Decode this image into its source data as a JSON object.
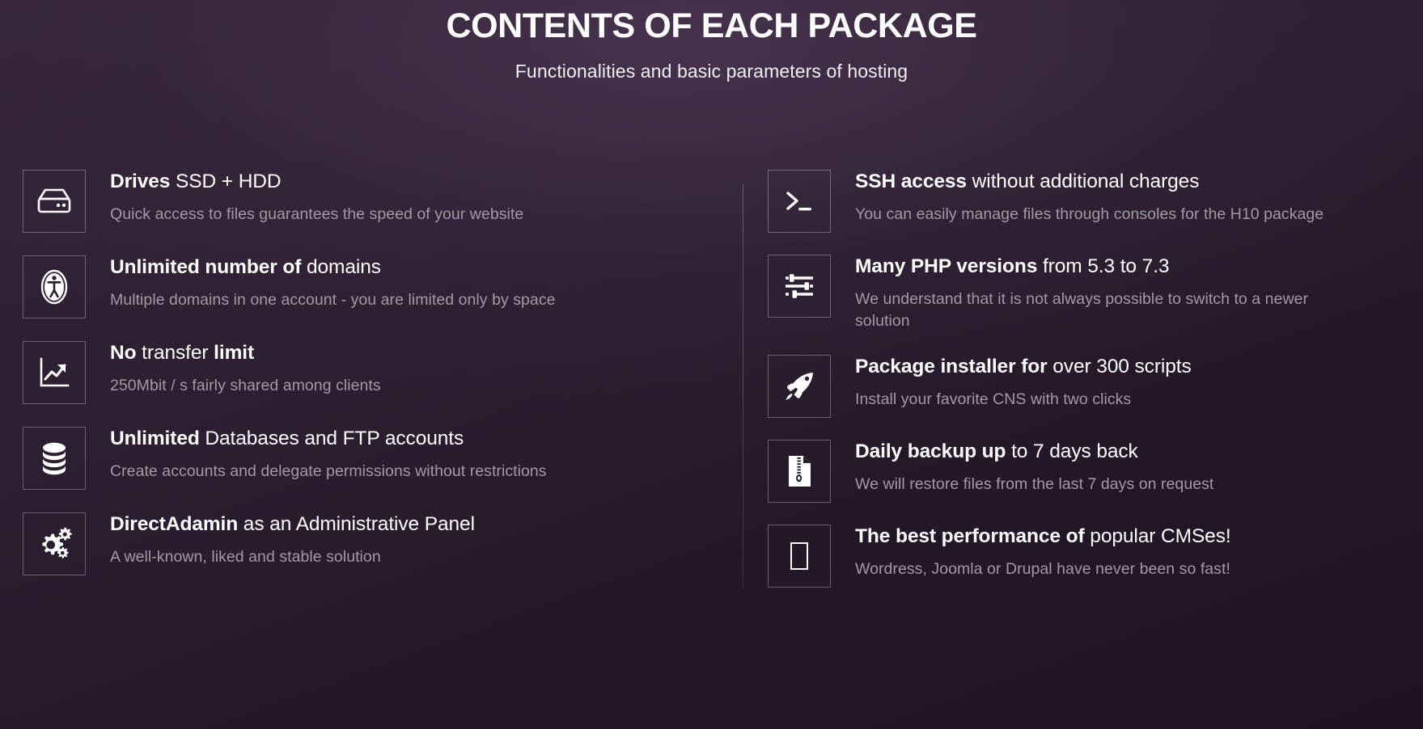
{
  "header": {
    "title": "CONTENTS OF EACH PACKAGE",
    "subtitle": "Functionalities and basic parameters of hosting"
  },
  "theme": {
    "background": "#2e2032",
    "text": "#ffffff",
    "muted_text": "#a09aa4",
    "icon_border": "rgba(255,255,255,0.30)"
  },
  "left_column": [
    {
      "icon": "hard-drive-icon",
      "title_bold": "Drives",
      "title_rest": " SSD + HDD",
      "desc": "Quick access to files guarantees the speed of your website"
    },
    {
      "icon": "accessibility-icon",
      "title_bold": "Unlimited number of",
      "title_rest": " domains",
      "desc": "Multiple domains in one account - you are limited only by space"
    },
    {
      "icon": "chart-growth-icon",
      "title_bold": "No",
      "title_mid": " transfer ",
      "title_bold2": "limit",
      "desc": "250Mbit / s fairly shared among clients"
    },
    {
      "icon": "database-icon",
      "title_bold": "Unlimited",
      "title_rest": " Databases and FTP accounts",
      "desc": "Create accounts and delegate permissions without restrictions"
    },
    {
      "icon": "gears-icon",
      "title_bold": "DirectAdamin",
      "title_rest": " as an Administrative Panel",
      "desc": "A well-known, liked and stable solution"
    }
  ],
  "right_column": [
    {
      "icon": "terminal-prompt-icon",
      "title_bold": "SSH access",
      "title_rest": " without additional charges",
      "desc": "You can easily manage files through consoles for the H10 package"
    },
    {
      "icon": "sliders-icon",
      "title_bold": "Many PHP versions",
      "title_rest": " from 5.3 to 7.3",
      "desc": "We understand that it is not always possible to switch to a newer solution"
    },
    {
      "icon": "rocket-icon",
      "title_bold": "Package installer for",
      "title_rest": " over 300 scripts",
      "desc": "Install your favorite CNS with two clicks"
    },
    {
      "icon": "zip-file-icon",
      "title_bold": "Daily backup up",
      "title_rest": " to 7 days back",
      "desc": "We will restore files from the last 7 days on request"
    },
    {
      "icon": "missing-glyph-icon",
      "title_bold": "The best performance of",
      "title_rest": " popular CMSes!",
      "desc": "Wordress, Joomla or Drupal have never been so fast!"
    }
  ]
}
